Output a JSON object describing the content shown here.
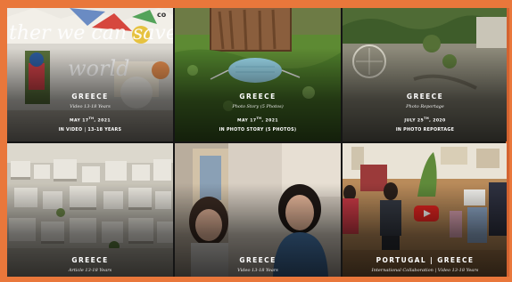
{
  "tiles": [
    {
      "country": "GREECE",
      "subtitle": "Video 13-18 Years",
      "date_main": "MAY 17",
      "date_sup": "TH",
      "date_year": ", 2021",
      "meta": "IN VIDEO | 13-18 YEARS",
      "overlay_text_1": "ther we can save",
      "overlay_text_2": "world",
      "overlay_text_3": "co"
    },
    {
      "country": "GREECE",
      "subtitle": "Photo Story (5 Photos)",
      "date_main": "MAY 17",
      "date_sup": "TH",
      "date_year": ", 2021",
      "meta": "IN PHOTO STORY (5 PHOTOS)"
    },
    {
      "country": "GREECE",
      "subtitle": "Photo Reportage",
      "date_main": "JULY 25",
      "date_sup": "TH",
      "date_year": ", 2020",
      "meta": "IN PHOTO REPORTAGE"
    },
    {
      "country": "GREECE",
      "subtitle": "Article 13-18 Years"
    },
    {
      "country": "GREECE",
      "subtitle": "Video 13-18 Years"
    },
    {
      "country": "PORTUGAL | GREECE",
      "subtitle": "International Collaboration | Video 13-18 Years",
      "has_play": true
    }
  ],
  "colors": {
    "frame": "#e9773b",
    "caption": "#ffffff",
    "play": "#e52420"
  },
  "icons": [
    "play-icon"
  ]
}
